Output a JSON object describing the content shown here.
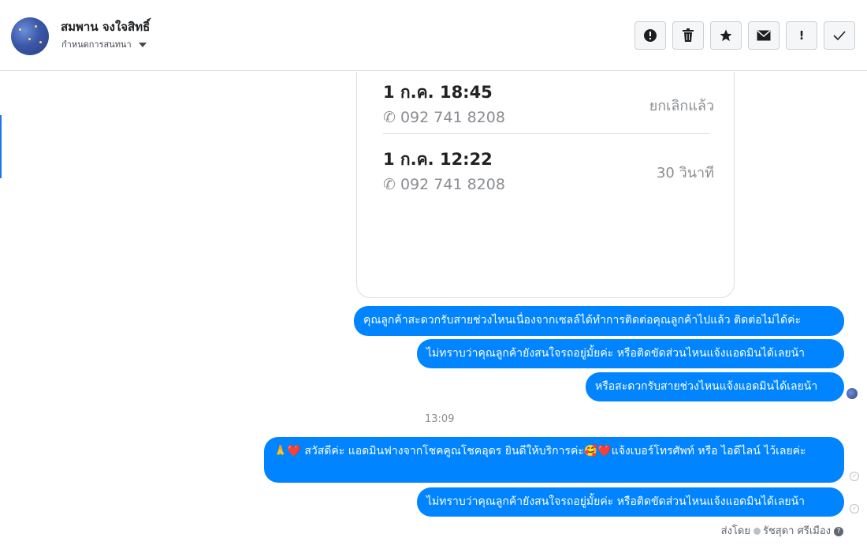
{
  "header": {
    "contact_name": "สมพาน จงใจสิทธิ์",
    "assign_label": "กำหนดการสนทนา",
    "toolbar": [
      {
        "name": "spam-report-button",
        "icon": "alert-circle-icon",
        "glyph": "!"
      },
      {
        "name": "delete-button",
        "icon": "trash-icon",
        "glyph": "🗑"
      },
      {
        "name": "star-button",
        "icon": "star-icon",
        "glyph": "★"
      },
      {
        "name": "mark-unread-button",
        "icon": "envelope-icon",
        "glyph": "✉"
      },
      {
        "name": "follow-up-button",
        "icon": "exclamation-icon",
        "glyph": "!"
      },
      {
        "name": "done-button",
        "icon": "check-icon",
        "glyph": "✓"
      }
    ]
  },
  "call_log": [
    {
      "datetime": "1 ก.ค. 18:45",
      "phone": "092 741 8208",
      "status": "ยกเลิกแล้ว"
    },
    {
      "datetime": "1 ก.ค. 12:22",
      "phone": "092 741 8208",
      "status": "30 วินาที"
    }
  ],
  "messages": [
    {
      "text": "คุณลูกค้าสะดวกรับสายช่วงไหนเนื่องจากเซลล์ได้ทำการติดต่อคุณลูกค้าไปแล้ว ติดต่อไม่ได้ค่ะ"
    },
    {
      "text": "ไม่ทราบว่าคุณลูกค้ายังสนใจรถอยู่มั้ยค่ะ  หรือติดขัดส่วนไหนแจ้งแอดมินได้เลยน้า"
    },
    {
      "text": "หรือสะดวกรับสายช่วงไหนแจ้งแอดมินได้เลยน้า"
    },
    {
      "text": "🙏❤️ สวัสดีค่ะ แอดมินฟางจากโชคคูณโชคอุดร ยินดีให้บริการค่ะ🥰❤️แจ้งเบอร์โทรศัพท์ หรือ ไอดีไลน์  ไว้เลยค่ะ"
    },
    {
      "text": "ไม่ทราบว่าคุณลูกค้ายังสนใจรถอยู่มั้ยค่ะ  หรือติดขัดส่วนไหนแจ้งแอดมินได้เลยน้า"
    }
  ],
  "timestamp": "13:09",
  "sent_by": {
    "prefix": "ส่งโดย",
    "agent": "รัชสุดา ศรีเมือง",
    "help_glyph": "?"
  },
  "colors": {
    "bubble": "#0084ff",
    "accent": "#1877f2"
  }
}
